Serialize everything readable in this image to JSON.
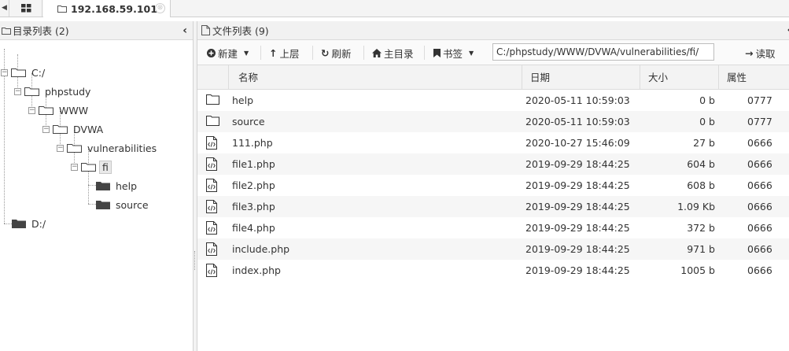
{
  "tabs": {
    "active_tab": "192.168.59.101",
    "close_symbol": "⊗"
  },
  "tree_panel": {
    "title": "目录列表 (2)",
    "nodes": {
      "c": "C:/",
      "phpstudy": "phpstudy",
      "www": "WWW",
      "dvwa": "DVWA",
      "vulnerabilities": "vulnerabilities",
      "fi": "fi",
      "help": "help",
      "source": "source",
      "d": "D:/"
    }
  },
  "file_panel": {
    "title": "文件列表 (9)",
    "toolbar": {
      "new_label": "新建",
      "up_label": "上层",
      "refresh_label": "刷新",
      "home_label": "主目录",
      "bookmark_label": "书签",
      "path_value": "C:/phpstudy/WWW/DVWA/vulnerabilities/fi/",
      "read_label": "读取"
    },
    "columns": {
      "name": "名称",
      "date": "日期",
      "size": "大小",
      "perm": "属性"
    },
    "files": [
      {
        "type": "folder",
        "name": "help",
        "date": "2020-05-11 10:59:03",
        "size": "0 b",
        "perm": "0777"
      },
      {
        "type": "folder",
        "name": "source",
        "date": "2020-05-11 10:59:03",
        "size": "0 b",
        "perm": "0777"
      },
      {
        "type": "code-file",
        "name": "111.php",
        "date": "2020-10-27 15:46:09",
        "size": "27 b",
        "perm": "0666"
      },
      {
        "type": "code-file",
        "name": "file1.php",
        "date": "2019-09-29 18:44:25",
        "size": "604 b",
        "perm": "0666"
      },
      {
        "type": "code-file",
        "name": "file2.php",
        "date": "2019-09-29 18:44:25",
        "size": "608 b",
        "perm": "0666"
      },
      {
        "type": "code-file",
        "name": "file3.php",
        "date": "2019-09-29 18:44:25",
        "size": "1.09 Kb",
        "perm": "0666"
      },
      {
        "type": "code-file",
        "name": "file4.php",
        "date": "2019-09-29 18:44:25",
        "size": "372 b",
        "perm": "0666"
      },
      {
        "type": "code-file",
        "name": "include.php",
        "date": "2019-09-29 18:44:25",
        "size": "971 b",
        "perm": "0666"
      },
      {
        "type": "code-file",
        "name": "index.php",
        "date": "2019-09-29 18:44:25",
        "size": "1005 b",
        "perm": "0666"
      }
    ]
  },
  "colors": {
    "row_alt": "#f6f6f6",
    "header_bg": "#f1f1f1",
    "text": "#333333"
  }
}
